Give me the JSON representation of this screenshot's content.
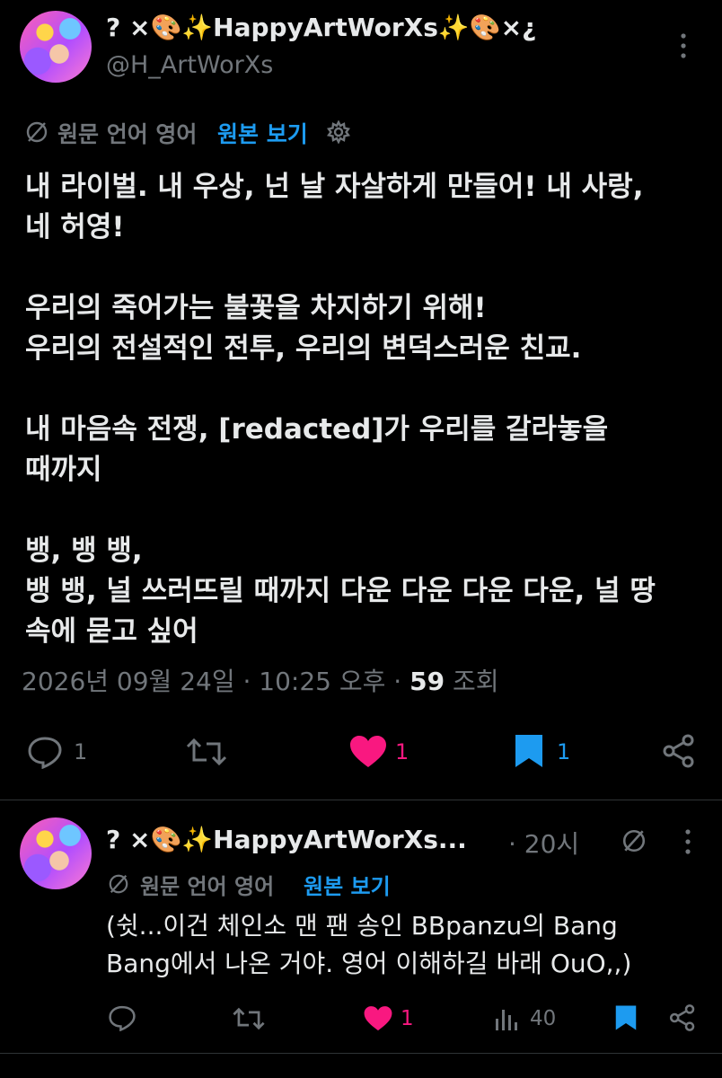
{
  "colors": {
    "background": "#000000",
    "text": "#e7e9ea",
    "muted": "#71767b",
    "link": "#1d9bf0",
    "like": "#f91880",
    "bookmark": "#1d9bf0"
  },
  "main_tweet": {
    "display_name": "? ×🎨✨HappyArtWorXs✨🎨×¿",
    "handle": "@H_ArtWorXs",
    "translation_notice": "원문 언어 영어",
    "show_original_label": "원본 보기",
    "lines": [
      "내 라이벌. 내 우상, 넌 날 자살하게 만들어! 내 사랑,",
      "네 허영!",
      "",
      "우리의 죽어가는 불꽃을 차지하기 위해!",
      "우리의 전설적인 전투, 우리의 변덕스러운 친교.",
      "",
      "내 마음속 전쟁, [redacted]가 우리를 갈라놓을",
      "때까지",
      "",
      "뱅, 뱅 뱅,",
      "뱅 뱅, 널 쓰러뜨릴 때까지 다운 다운 다운 다운, 널 땅",
      "속에 묻고 싶어"
    ],
    "timestamp": "2026년 09월 24일 · 10:25 오후 · ",
    "views_count": "59",
    "views_label": "조회",
    "reply_count": "1",
    "like_count": "1",
    "bookmark_count": "1"
  },
  "reply_tweet": {
    "display_name": "? ×🎨✨HappyArtWorXs...",
    "time": "· 20시",
    "translation_notice": "원문 언어 영어",
    "show_original_label": "원본 보기",
    "lines": [
      "(쉿...이건 체인소 맨 팬 송인 BBpanzu의 Bang",
      "Bang에서 나온 거야. 영어 이해하길 바래 OuO,,)"
    ],
    "like_count": "1",
    "views_count": "40"
  }
}
